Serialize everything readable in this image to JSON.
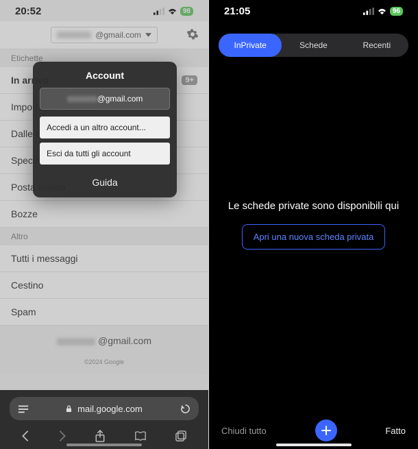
{
  "left": {
    "status": {
      "time": "20:52",
      "battery": "98"
    },
    "account_chip_suffix": "@gmail.com",
    "sections": {
      "labels_header": "Etichette",
      "inbox": "In arrivo",
      "inbox_badge": "9+",
      "important": "Importanti",
      "from_circles": "Dalle cerchie",
      "special": "Speciali",
      "sent": "Posta inviata",
      "drafts": "Bozze",
      "other_header": "Altro",
      "all_mail": "Tutti i messaggi",
      "trash": "Cestino",
      "spam": "Spam"
    },
    "footer_email_suffix": "@gmail.com",
    "copyright": "©2024 Google",
    "url": "mail.google.com",
    "modal": {
      "title": "Account",
      "current_suffix": "@gmail.com",
      "add_account": "Accedi a un altro account...",
      "signout_all": "Esci da tutti gli account",
      "help": "Guida"
    }
  },
  "right": {
    "status": {
      "time": "21:05",
      "battery": "96"
    },
    "segments": {
      "inprivate": "InPrivate",
      "tabs": "Schede",
      "recent": "Recenti"
    },
    "empty_message": "Le schede private sono disponibili qui",
    "open_button": "Apri una nuova scheda privata",
    "bottom": {
      "close_all": "Chiudi tutto",
      "done": "Fatto"
    }
  }
}
